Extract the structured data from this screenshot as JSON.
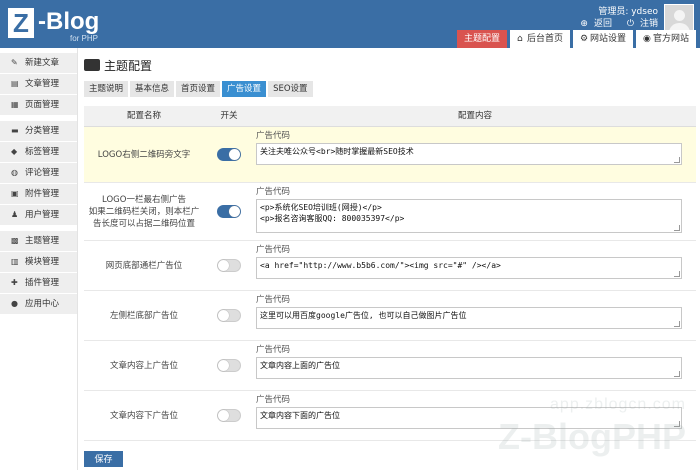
{
  "brand": {
    "logo_letter": "Z",
    "logo_text": "-Blog",
    "logo_sub": "for PHP"
  },
  "user": {
    "admin_label": "管理员: ydseo",
    "back_link": "返回",
    "logout_link": "注销"
  },
  "topnav": [
    {
      "label": "主题配置",
      "icon": "",
      "active": true
    },
    {
      "label": "后台首页",
      "icon": "home-icon",
      "active": false
    },
    {
      "label": "网站设置",
      "icon": "gear-icon",
      "active": false
    },
    {
      "label": "官方网站",
      "icon": "user-icon",
      "active": false
    }
  ],
  "sidebar": {
    "items": [
      {
        "label": "新建文章",
        "icon": "edit-icon"
      },
      {
        "label": "文章管理",
        "icon": "article-icon"
      },
      {
        "label": "页面管理",
        "icon": "page-icon"
      },
      {
        "label": "分类管理",
        "icon": "folder-icon"
      },
      {
        "label": "标签管理",
        "icon": "tag-icon"
      },
      {
        "label": "评论管理",
        "icon": "comment-icon"
      },
      {
        "label": "附件管理",
        "icon": "attachment-icon"
      },
      {
        "label": "用户管理",
        "icon": "users-icon"
      },
      {
        "label": "主题管理",
        "icon": "theme-icon"
      },
      {
        "label": "模块管理",
        "icon": "module-icon"
      },
      {
        "label": "插件管理",
        "icon": "plugin-icon"
      },
      {
        "label": "应用中心",
        "icon": "app-center-icon"
      }
    ]
  },
  "page": {
    "title": "主题配置",
    "subtabs": [
      {
        "label": "主题说明",
        "active": false
      },
      {
        "label": "基本信息",
        "active": false
      },
      {
        "label": "首页设置",
        "active": false
      },
      {
        "label": "广告设置",
        "active": true
      },
      {
        "label": "SEO设置",
        "active": false
      }
    ]
  },
  "table": {
    "headers": {
      "name": "配置名称",
      "switch": "开关",
      "content": "配置内容"
    },
    "rows": [
      {
        "name": "LOGO右侧二维码旁文字",
        "on": true,
        "highlight": true,
        "label": "广告代码",
        "value": "关注夫唯公众号<br>随时掌握最新SEO技术"
      },
      {
        "name": "LOGO一栏最右侧广告\n如果二维码栏关闭，则本栏广告长度可以占据二维码位置",
        "on": true,
        "highlight": false,
        "label": "广告代码",
        "value": "<p>系统化SEO培训班(网授)</p>\n<p>报名咨询客服QQ: 800035397</p>"
      },
      {
        "name": "网页底部通栏广告位",
        "on": false,
        "highlight": false,
        "label": "广告代码",
        "value": "<a href=\"http://www.b5b6.com/\"><img src=\"#\" /></a>"
      },
      {
        "name": "左侧栏底部广告位",
        "on": false,
        "highlight": false,
        "label": "广告代码",
        "value": "这里可以用百度google广告位, 也可以自己做图片广告位"
      },
      {
        "name": "文章内容上广告位",
        "on": false,
        "highlight": false,
        "label": "广告代码",
        "value": "文章内容上面的广告位"
      },
      {
        "name": "文章内容下广告位",
        "on": false,
        "highlight": false,
        "label": "广告代码",
        "value": "文章内容下面的广告位"
      }
    ]
  },
  "actions": {
    "save_label": "保存"
  },
  "watermark": {
    "url": "app.zblogcn.com",
    "brand": "Z-BlogPHP"
  },
  "colors": {
    "header": "#3a6ea5",
    "active_nav": "#d9534f",
    "active_subtab": "#3a8fd1",
    "highlight_row": "#fffde0"
  }
}
